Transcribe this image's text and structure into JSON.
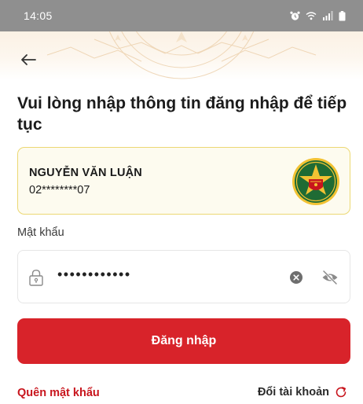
{
  "status_bar": {
    "time": "14:05",
    "icons": [
      "alarm-icon",
      "wifi-icon",
      "signal-icon",
      "battery-icon"
    ]
  },
  "header": {
    "back_icon": "arrow-left-icon",
    "title": "Vui lòng nhập thông tin đăng nhập để tiếp tục"
  },
  "account": {
    "name": "NGUYỄN VĂN LUẬN",
    "phone": "02********07",
    "badge_icon": "police-emblem-icon"
  },
  "password": {
    "label": "Mật khẩu",
    "value": "••••••••••••",
    "lock_icon": "lock-icon",
    "clear_icon": "clear-icon",
    "visibility_icon": "eye-off-icon"
  },
  "actions": {
    "login_label": "Đăng nhập",
    "forgot_label": "Quên mật khẩu",
    "switch_label": "Đổi tài khoản",
    "switch_icon": "refresh-icon"
  },
  "colors": {
    "primary_red": "#d8232a",
    "link_red": "#c8151d",
    "card_border": "#ecd873",
    "card_bg": "#fdfbef",
    "status_bar": "#8f8f8f"
  }
}
